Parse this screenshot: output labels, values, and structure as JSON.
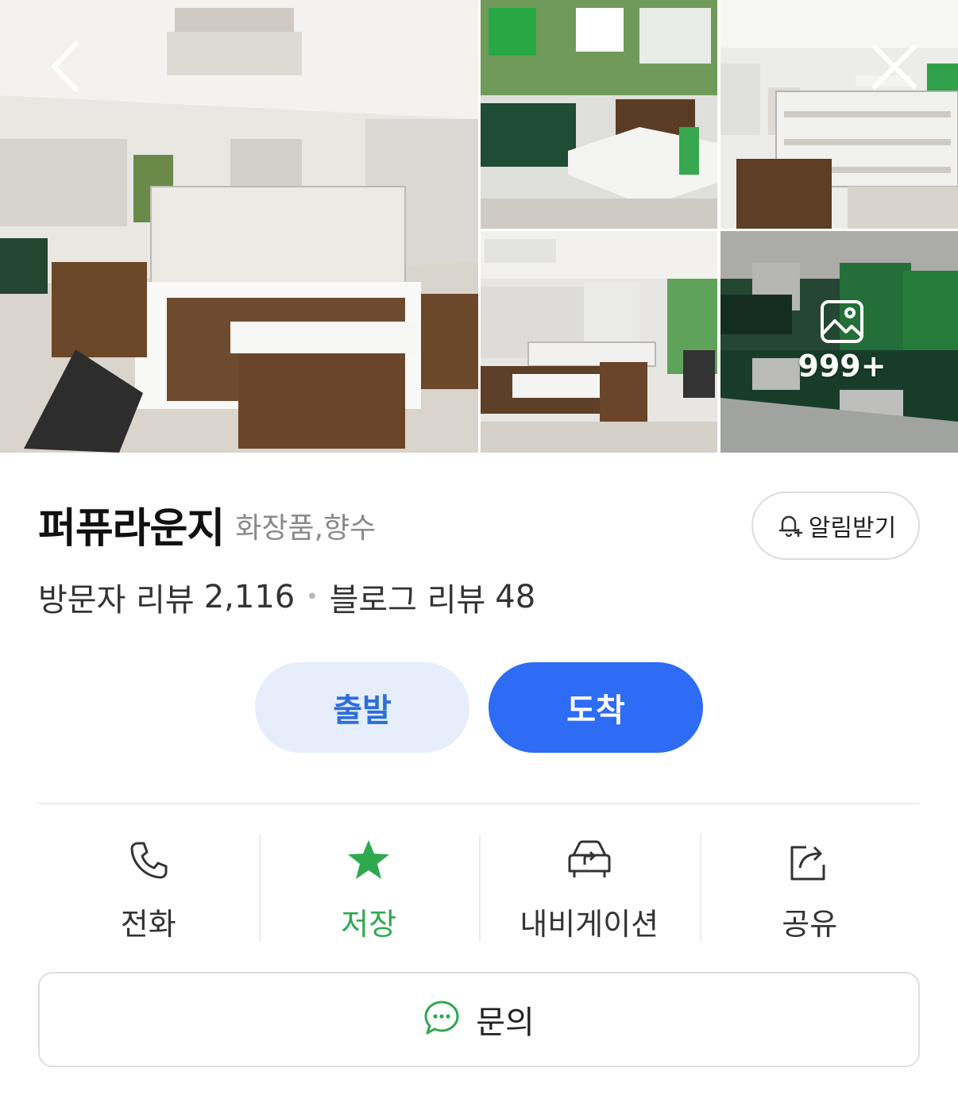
{
  "place": {
    "name": "퍼퓨라운지",
    "category": "화장품,향수",
    "visitor_reviews_label": "방문자 리뷰",
    "visitor_reviews_count": "2,116",
    "blog_reviews_label": "블로그 리뷰",
    "blog_reviews_count": "48"
  },
  "gallery": {
    "more_count": "999+"
  },
  "header": {
    "alarm_label": "알림받기"
  },
  "route": {
    "depart_label": "출발",
    "arrive_label": "도착"
  },
  "actions": [
    {
      "label": "전화",
      "icon": "phone-icon"
    },
    {
      "label": "저장",
      "icon": "star-icon"
    },
    {
      "label": "내비게이션",
      "icon": "navigation-car-icon"
    },
    {
      "label": "공유",
      "icon": "share-icon"
    }
  ],
  "inquiry": {
    "label": "문의",
    "icon": "chat-bubble-icon"
  },
  "colors": {
    "accent_blue": "#2e6cf5",
    "light_blue": "#e6eefb",
    "save_green": "#2fa84f"
  }
}
